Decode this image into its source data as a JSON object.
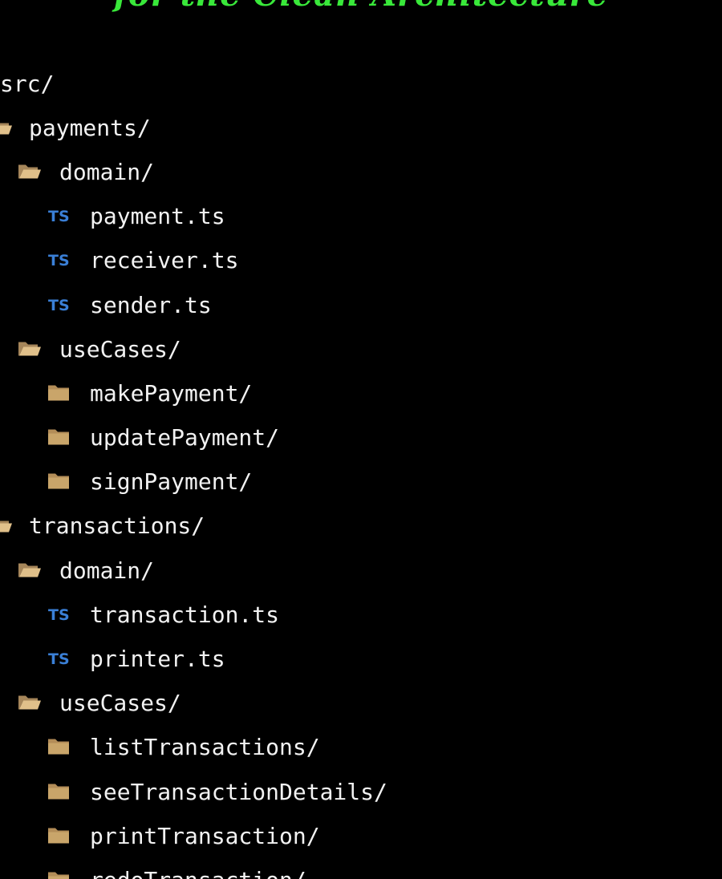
{
  "header": {
    "title": "for the Clean Architecture",
    "title_color": "#39e83a"
  },
  "tree": {
    "root": "src/",
    "payments": {
      "label": "payments/",
      "domain": {
        "label": "domain/",
        "files": [
          "payment.ts",
          "receiver.ts",
          "sender.ts"
        ]
      },
      "use_cases": {
        "label": "useCases/",
        "folders": [
          "makePayment/",
          "updatePayment/",
          "signPayment/"
        ]
      }
    },
    "transactions": {
      "label": "transactions/",
      "domain": {
        "label": "domain/",
        "files": [
          "transaction.ts",
          "printer.ts"
        ]
      },
      "use_cases": {
        "label": "useCases/",
        "folders": [
          "listTransactions/",
          "seeTransactionDetails/",
          "printTransaction/",
          "redoTransaction/"
        ]
      }
    }
  },
  "icons": {
    "typescript_file": "TS",
    "typescript_color": "#3a7fd6",
    "folder_color": "#c9a56a",
    "folder_open": "folder-open-icon",
    "folder_closed": "folder-icon"
  }
}
